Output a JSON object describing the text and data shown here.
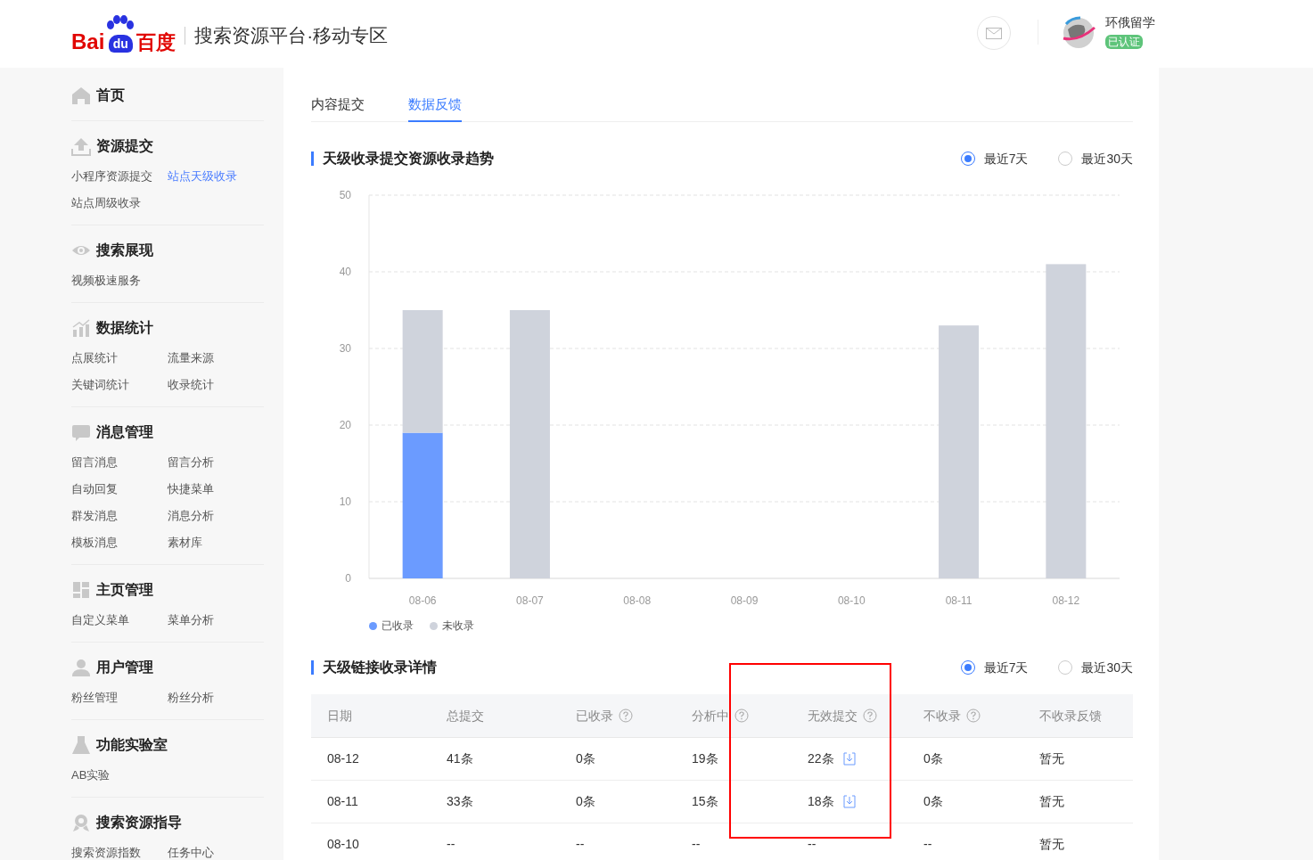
{
  "header": {
    "logo": {
      "left": "Bai",
      "paw": "du",
      "right": "百度"
    },
    "title": "搜索资源平台·移动专区",
    "user": {
      "name": "环俄留学",
      "badge": "已认证"
    }
  },
  "sidebar": {
    "sections": [
      {
        "title": "首页"
      },
      {
        "title": "资源提交",
        "items": [
          {
            "label": "小程序资源提交",
            "selected": false
          },
          {
            "label": "站点天级收录",
            "selected": true
          },
          {
            "label": "站点周级收录",
            "selected": false
          }
        ]
      },
      {
        "title": "搜索展现",
        "items": [
          {
            "label": "视频极速服务",
            "selected": false
          }
        ]
      },
      {
        "title": "数据统计",
        "items": [
          {
            "label": "点展统计",
            "selected": false
          },
          {
            "label": "流量来源",
            "selected": false
          },
          {
            "label": "关键词统计",
            "selected": false
          },
          {
            "label": "收录统计",
            "selected": false
          }
        ]
      },
      {
        "title": "消息管理",
        "items": [
          {
            "label": "留言消息",
            "selected": false
          },
          {
            "label": "留言分析",
            "selected": false
          },
          {
            "label": "自动回复",
            "selected": false
          },
          {
            "label": "快捷菜单",
            "selected": false
          },
          {
            "label": "群发消息",
            "selected": false
          },
          {
            "label": "消息分析",
            "selected": false
          },
          {
            "label": "模板消息",
            "selected": false
          },
          {
            "label": "素材库",
            "selected": false
          }
        ]
      },
      {
        "title": "主页管理",
        "items": [
          {
            "label": "自定义菜单",
            "selected": false
          },
          {
            "label": "菜单分析",
            "selected": false
          }
        ]
      },
      {
        "title": "用户管理",
        "items": [
          {
            "label": "粉丝管理",
            "selected": false
          },
          {
            "label": "粉丝分析",
            "selected": false
          }
        ]
      },
      {
        "title": "功能实验室",
        "items": [
          {
            "label": "AB实验",
            "selected": false
          }
        ]
      },
      {
        "title": "搜索资源指导",
        "items": [
          {
            "label": "搜索资源指数",
            "selected": false
          },
          {
            "label": "任务中心",
            "selected": false
          }
        ]
      }
    ]
  },
  "tabs": [
    {
      "label": "内容提交",
      "selected": false
    },
    {
      "label": "数据反馈",
      "selected": true
    }
  ],
  "trend": {
    "title": "天级收录提交资源收录趋势",
    "range_options": [
      {
        "label": "最近7天",
        "selected": true
      },
      {
        "label": "最近30天",
        "selected": false
      }
    ],
    "chart_data": {
      "type": "bar",
      "stacked": true,
      "categories": [
        "08-06",
        "08-07",
        "08-08",
        "08-09",
        "08-10",
        "08-11",
        "08-12"
      ],
      "series": [
        {
          "name": "已收录",
          "color": "#6b9bff",
          "values": [
            19,
            0,
            null,
            null,
            null,
            0,
            0
          ]
        },
        {
          "name": "未收录",
          "color": "#cfd3dc",
          "values": [
            16,
            35,
            null,
            null,
            null,
            33,
            41
          ]
        }
      ],
      "ylim": [
        0,
        50
      ],
      "yticks": [
        0,
        10,
        20,
        30,
        40,
        50
      ],
      "grid": true
    }
  },
  "details": {
    "title": "天级链接收录详情",
    "range_options": [
      {
        "label": "最近7天",
        "selected": true
      },
      {
        "label": "最近30天",
        "selected": false
      }
    ],
    "table": {
      "columns": [
        {
          "label": "日期",
          "help": false
        },
        {
          "label": "总提交",
          "help": false
        },
        {
          "label": "已收录",
          "help": true
        },
        {
          "label": "分析中",
          "help": true
        },
        {
          "label": "无效提交",
          "help": true
        },
        {
          "label": "不收录",
          "help": true
        },
        {
          "label": "不收录反馈",
          "help": false
        }
      ],
      "rows": [
        {
          "cells": [
            "08-12",
            "41条",
            "0条",
            "19条",
            "22条",
            "0条",
            "暂无"
          ],
          "download": true
        },
        {
          "cells": [
            "08-11",
            "33条",
            "0条",
            "15条",
            "18条",
            "0条",
            "暂无"
          ],
          "download": true
        },
        {
          "cells": [
            "08-10",
            "--",
            "--",
            "--",
            "--",
            "--",
            "暂无"
          ],
          "download": false
        }
      ]
    }
  }
}
